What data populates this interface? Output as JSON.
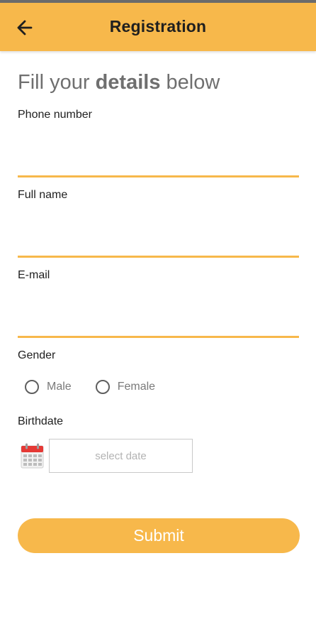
{
  "appbar": {
    "title": "Registration",
    "back_icon": "arrow-left-icon"
  },
  "heading": {
    "pre": "Fill your ",
    "bold": "details",
    "post": " below"
  },
  "fields": {
    "phone": {
      "label": "Phone number",
      "value": ""
    },
    "fullname": {
      "label": "Full name",
      "value": ""
    },
    "email": {
      "label": "E-mail",
      "value": ""
    }
  },
  "gender": {
    "label": "Gender",
    "options": [
      "Male",
      "Female"
    ],
    "selected": null
  },
  "birthdate": {
    "label": "Birthdate",
    "placeholder": "select date",
    "icon": "calendar-icon"
  },
  "submit": {
    "label": "Submit"
  },
  "colors": {
    "accent": "#f7b84b",
    "text": "#212121",
    "muted": "#7a7a7a",
    "calendar_red": "#e53935"
  }
}
